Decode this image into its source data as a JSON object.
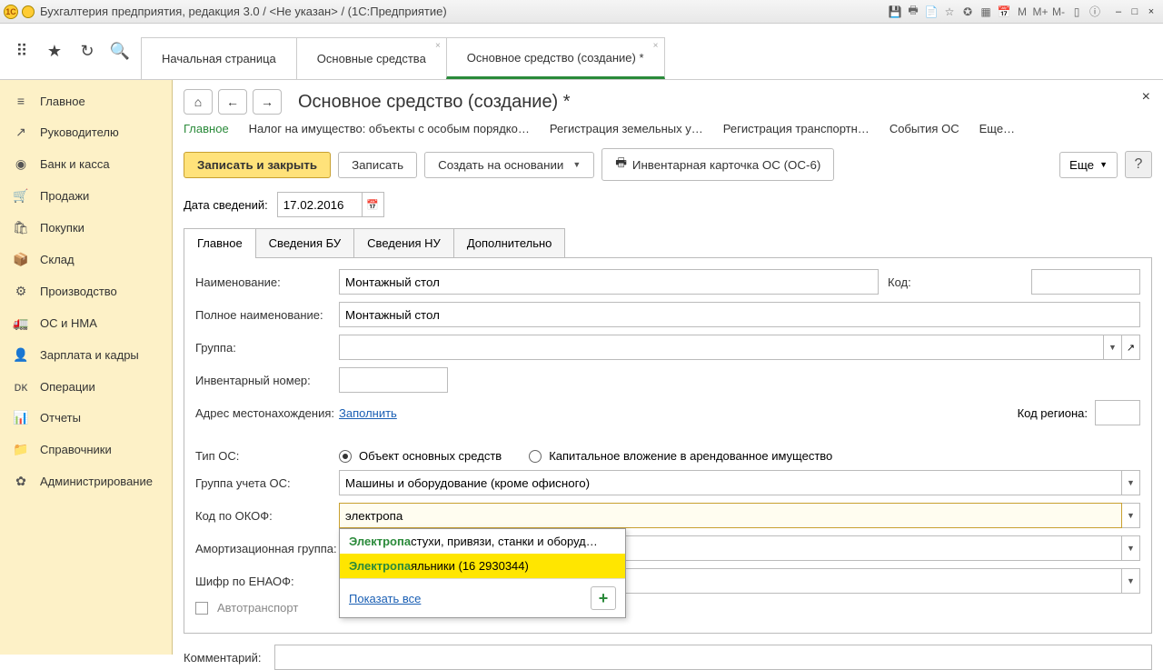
{
  "titlebar": {
    "title": "Бухгалтерия предприятия, редакция 3.0 / <Не указан> / (1С:Предприятие)"
  },
  "top_tabs": {
    "home": "Начальная страница",
    "tab1": "Основные средства",
    "tab2": "Основное средство (создание) *"
  },
  "sidebar": {
    "items": [
      {
        "icon": "≡",
        "label": "Главное"
      },
      {
        "icon": "↗",
        "label": "Руководителю"
      },
      {
        "icon": "◉",
        "label": "Банк и касса"
      },
      {
        "icon": "🛒",
        "label": "Продажи"
      },
      {
        "icon": "🛍",
        "label": "Покупки"
      },
      {
        "icon": "📦",
        "label": "Склад"
      },
      {
        "icon": "⚙",
        "label": "Производство"
      },
      {
        "icon": "🚛",
        "label": "ОС и НМА"
      },
      {
        "icon": "👤",
        "label": "Зарплата и кадры"
      },
      {
        "icon": "ᴅᴋ",
        "label": "Операции"
      },
      {
        "icon": "📊",
        "label": "Отчеты"
      },
      {
        "icon": "📁",
        "label": "Справочники"
      },
      {
        "icon": "✿",
        "label": "Администрирование"
      }
    ]
  },
  "page": {
    "title": "Основное средство (создание) *",
    "sections": {
      "s0": "Главное",
      "s1": "Налог на имущество: объекты с особым порядко…",
      "s2": "Регистрация земельных у…",
      "s3": "Регистрация транспортн…",
      "s4": "События ОС",
      "s5": "Еще…"
    },
    "actions": {
      "save_close": "Записать и закрыть",
      "save": "Записать",
      "create_based": "Создать на основании",
      "inv_card": "Инвентарная карточка ОС (ОС-6)",
      "more": "Еще",
      "help": "?"
    },
    "date_label": "Дата сведений:",
    "date_value": "17.02.2016",
    "form_tabs": {
      "t0": "Главное",
      "t1": "Сведения БУ",
      "t2": "Сведения НУ",
      "t3": "Дополнительно"
    },
    "fields": {
      "name_lbl": "Наименование:",
      "name_val": "Монтажный стол",
      "fullname_lbl": "Полное наименование:",
      "fullname_val": "Монтажный стол",
      "group_lbl": "Группа:",
      "group_val": "",
      "invnum_lbl": "Инвентарный номер:",
      "invnum_val": "",
      "address_lbl": "Адрес местонахождения:",
      "address_link": "Заполнить",
      "region_lbl": "Код региона:",
      "code_lbl": "Код:",
      "type_lbl": "Тип ОС:",
      "type_opt1": "Объект основных средств",
      "type_opt2": "Капитальное вложение в арендованное имущество",
      "acct_group_lbl": "Группа учета ОС:",
      "acct_group_val": "Машины и оборудование (кроме офисного)",
      "okof_lbl": "Код по ОКОФ:",
      "okof_val": "электропа",
      "amort_lbl": "Амортизационная группа:",
      "enaof_lbl": "Шифр по ЕНАОФ:",
      "auto_lbl": "Автотранспорт",
      "comment_lbl": "Комментарий:"
    },
    "autocomplete": {
      "match": "Электропа",
      "item1_rest": "стухи, привязи, станки и оборуд…",
      "item2_rest": "яльники (16 2930344)",
      "show_all": "Показать все"
    }
  }
}
